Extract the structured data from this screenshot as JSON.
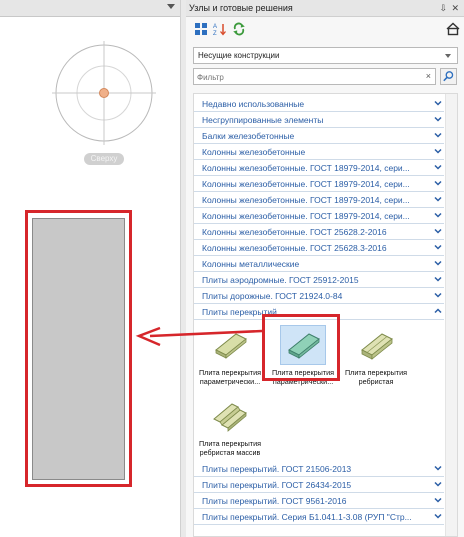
{
  "left_view": {
    "view_label": "Сверху"
  },
  "panel": {
    "title": "Узлы и готовые решения",
    "pin_glyph": "⇩",
    "close_glyph": "✕",
    "toolbar_icons": [
      "grid-view-icon",
      "sort-az-icon",
      "refresh-icon",
      "home-icon"
    ],
    "category_select": "Несущие конструкции",
    "filter_placeholder": "Фильтр",
    "filter_clear": "×"
  },
  "categories_top": [
    {
      "label": "Недавно использованные",
      "state": "collapsed"
    },
    {
      "label": "Несгруппированные элементы",
      "state": "collapsed"
    },
    {
      "label": "Балки железобетонные",
      "state": "collapsed"
    },
    {
      "label": "Колонны железобетонные",
      "state": "collapsed"
    },
    {
      "label": "Колонны железобетонные. ГОСТ 18979-2014, сери...",
      "state": "collapsed"
    },
    {
      "label": "Колонны железобетонные. ГОСТ 18979-2014, сери...",
      "state": "collapsed"
    },
    {
      "label": "Колонны железобетонные. ГОСТ 18979-2014, сери...",
      "state": "collapsed"
    },
    {
      "label": "Колонны железобетонные. ГОСТ 18979-2014, сери...",
      "state": "collapsed"
    },
    {
      "label": "Колонны железобетонные. ГОСТ 25628.2-2016",
      "state": "collapsed"
    },
    {
      "label": "Колонны железобетонные. ГОСТ 25628.3-2016",
      "state": "collapsed"
    },
    {
      "label": "Колонны металлические",
      "state": "collapsed"
    },
    {
      "label": "Плиты аэродромные. ГОСТ 25912-2015",
      "state": "collapsed"
    },
    {
      "label": "Плиты дорожные. ГОСТ 21924.0-84",
      "state": "collapsed"
    },
    {
      "label": "Плиты перекрытий",
      "state": "expanded"
    }
  ],
  "items": [
    {
      "caption_1": "Плита перекрытия",
      "caption_2": "параметрически...",
      "selected": false
    },
    {
      "caption_1": "Плита перекрытия",
      "caption_2": "параметрически...",
      "selected": true
    },
    {
      "caption_1": "Плита перекрытия",
      "caption_2": "ребристая",
      "selected": false
    },
    {
      "caption_1": "Плита перекрытия",
      "caption_2": "ребристая массив",
      "selected": false
    }
  ],
  "categories_bottom": [
    {
      "label": "Плиты перекрытий. ГОСТ 21506-2013",
      "state": "collapsed"
    },
    {
      "label": "Плиты перекрытий. ГОСТ 26434-2015",
      "state": "collapsed"
    },
    {
      "label": "Плиты перекрытий. ГОСТ 9561-2016",
      "state": "collapsed"
    },
    {
      "label": "Плиты перекрытий. Серия Б1.041.1-3.08 (РУП \"Стр...",
      "state": "collapsed"
    }
  ],
  "colors": {
    "category_text": "#2b5ea6",
    "highlight_red": "#d6262b",
    "selection_bg": "#cfe4f7",
    "slab_fill": "#c8c8c8"
  }
}
